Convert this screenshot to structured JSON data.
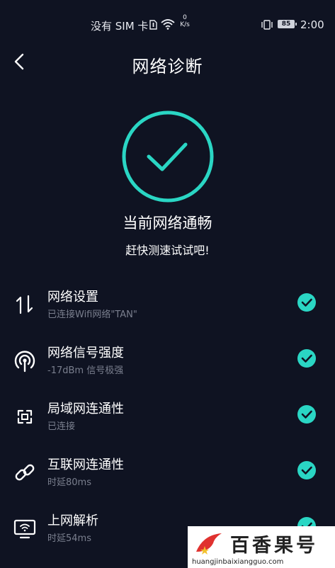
{
  "status_bar": {
    "carrier": "没有 SIM 卡",
    "speed_value": "0",
    "speed_unit": "K/s",
    "battery": "85",
    "time": "2:00"
  },
  "header": {
    "title": "网络诊断"
  },
  "status": {
    "main": "当前网络通畅",
    "sub": "赶快测速试试吧!"
  },
  "items": [
    {
      "name": "网络设置",
      "desc": "已连接Wifi网络\"TAN\"",
      "icon": "transfer-arrows-icon"
    },
    {
      "name": "网络信号强度",
      "desc": "-17dBm 信号极强",
      "icon": "signal-tower-icon"
    },
    {
      "name": "局域网连通性",
      "desc": "已连接",
      "icon": "lan-frame-icon"
    },
    {
      "name": "互联网连通性",
      "desc": "时延80ms",
      "icon": "link-icon"
    },
    {
      "name": "上网解析",
      "desc": "时延54ms",
      "icon": "monitor-wifi-icon"
    }
  ],
  "watermark": {
    "name": "百香果号",
    "url": "huangjinbaixiangguo.com"
  },
  "colors": {
    "background": "#0f1322",
    "accent": "#2ad6c4",
    "secondary_text": "#7a7f8e"
  }
}
